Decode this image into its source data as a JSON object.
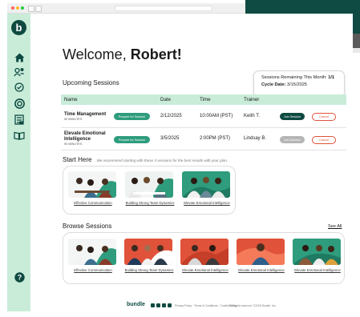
{
  "app": {
    "logo_letter": "b",
    "brand": "bundle"
  },
  "sidebar": {
    "items": [
      {
        "icon": "home-icon"
      },
      {
        "icon": "people-icon"
      },
      {
        "icon": "check-icon"
      },
      {
        "icon": "target-icon"
      },
      {
        "icon": "tasks-icon"
      },
      {
        "icon": "book-icon"
      }
    ],
    "help_icon": "help-icon"
  },
  "welcome": {
    "greeting": "Welcome,",
    "name": "Robert!"
  },
  "remaining": {
    "sessions_label": "Sessions Remaining This Month:",
    "sessions_value": "1/1",
    "cycle_label": "Cycle Date:",
    "cycle_value": "3/15/2025"
  },
  "upcoming": {
    "title": "Upcoming Sessions",
    "columns": [
      "Name",
      "Date",
      "Time",
      "Trainer"
    ],
    "rows": [
      {
        "name": "Time Management",
        "duration": "90 MINUTES",
        "prepare": "Prepare for Session",
        "date": "2/12/2025",
        "time": "10:00AM (PST)",
        "trainer": "Keith T.",
        "join": "Join Session",
        "cancel": "Cancel"
      },
      {
        "name": "Elevate Emotional Intelligence",
        "duration": "90 MINUTES",
        "prepare": "Prepare for Session",
        "date": "3/5/2025",
        "time": "2:00PM (PST)",
        "trainer": "Lindsay B.",
        "join": "Join Session",
        "cancel": "Cancel"
      }
    ]
  },
  "start_here": {
    "title": "Start Here",
    "note": "We recommend starting with these 3 sessions for the best results with your plan.",
    "cards": [
      {
        "label": "Effective Communication"
      },
      {
        "label": "Building Strong Team Dynamics"
      },
      {
        "label": "Elevate Emotional Intelligence"
      }
    ]
  },
  "browse": {
    "title": "Browse Sessions",
    "see_all": "See All",
    "cards": [
      {
        "label": "Effective Communication"
      },
      {
        "label": "Building Strong Team Dynamics"
      },
      {
        "label": "Elevate Emotional Intelligence"
      },
      {
        "label": "Elevate Emotional Intelligence"
      },
      {
        "label": "Elevate Emotional Intelligence"
      }
    ]
  },
  "footer": {
    "links": "Privacy Policy · Terms & Conditions · Cookie Policy",
    "copyright": "| All rights reserved. ©2025 Bundle, Inc."
  },
  "colors": {
    "accent": "#0e4a41",
    "mint": "#c9ecd9",
    "green_button": "#2e9c7d",
    "cancel": "#e0523a"
  }
}
